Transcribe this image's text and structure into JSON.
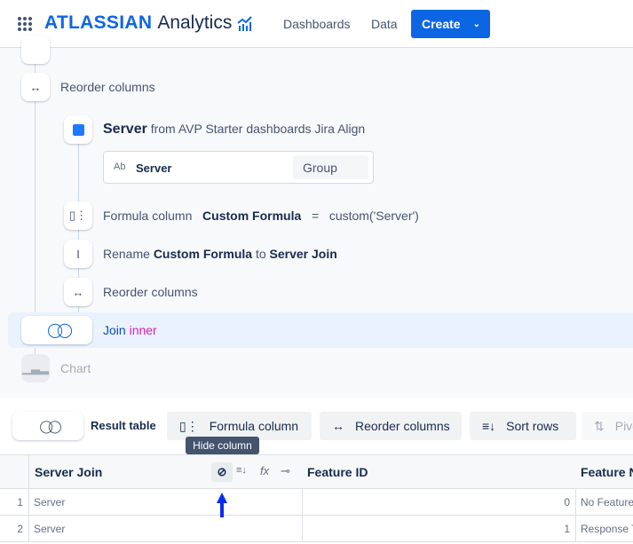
{
  "header": {
    "brand": "ATLASSIAN",
    "product": "Analytics",
    "nav": [
      "Dashboards",
      "Data"
    ],
    "create_label": "Create"
  },
  "pipeline": {
    "reorder1": "Reorder columns",
    "source": {
      "name": "Server",
      "from": "from AVP Starter dashboards Jira Align"
    },
    "field": {
      "type": "Ab",
      "name": "Server",
      "role": "Group"
    },
    "formula": {
      "label": "Formula column",
      "name": "Custom Formula",
      "eq": "=",
      "expr": "custom('Server')"
    },
    "rename": {
      "prefix": "Rename",
      "from": "Custom Formula",
      "to_word": "to",
      "to": "Server Join"
    },
    "reorder2": "Reorder columns",
    "join": {
      "label": "Join",
      "type": "inner"
    },
    "chart": "Chart"
  },
  "toolbar": {
    "result_label": "Result table",
    "buttons": [
      "Formula column",
      "Reorder columns",
      "Sort rows",
      "Pivot"
    ]
  },
  "tooltip": "Hide column",
  "table": {
    "columns": [
      "Server Join",
      "Feature ID",
      "Feature N"
    ],
    "rows": [
      {
        "n": "1",
        "server": "Server",
        "id": "0",
        "name": "No Feature"
      },
      {
        "n": "2",
        "server": "Server",
        "id": "1",
        "name": "Response T"
      }
    ]
  },
  "colors": {
    "accent": "#0c66e4",
    "join_type": "#e11cb4",
    "highlight": "#e9f2fd"
  }
}
